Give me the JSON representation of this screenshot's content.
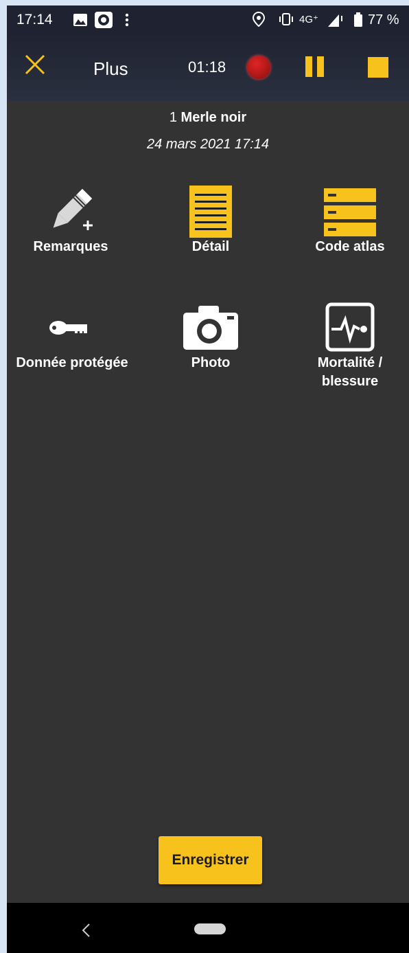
{
  "status_bar": {
    "time": "17:14",
    "network": "4G⁺",
    "battery": "77 %"
  },
  "app_bar": {
    "title": "Plus",
    "timer": "01:18",
    "accent_color": "#f7c21b"
  },
  "observation": {
    "count": "1",
    "species": "Merle noir",
    "datetime": "24 mars 2021 17:14"
  },
  "actions": [
    {
      "label": "Remarques",
      "icon": "pencil-plus-icon"
    },
    {
      "label": "Détail",
      "icon": "document-icon"
    },
    {
      "label": "Code atlas",
      "icon": "server-stack-icon"
    },
    {
      "label": "Donnée protégée",
      "icon": "key-icon"
    },
    {
      "label": "Photo",
      "icon": "camera-icon"
    },
    {
      "label": "Mortalité /",
      "label2": "blessure",
      "icon": "heart-monitor-icon"
    }
  ],
  "save_button": {
    "label": "Enregistrer"
  }
}
